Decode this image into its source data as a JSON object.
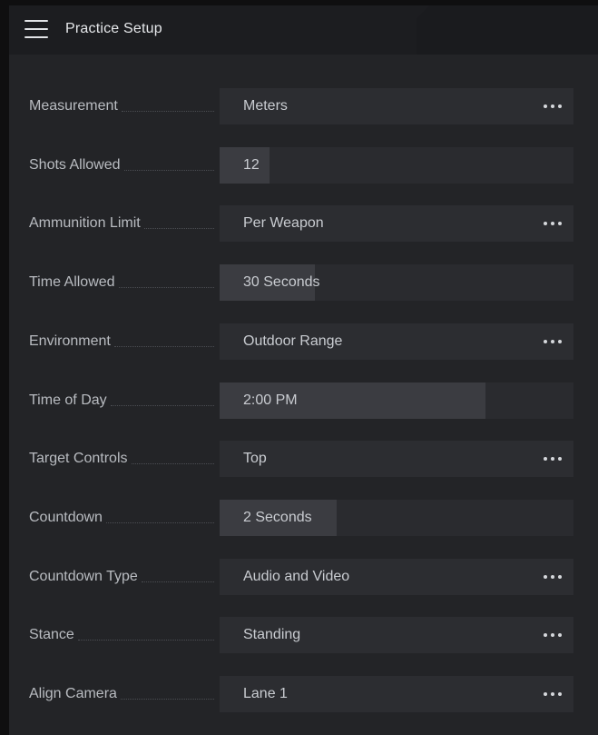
{
  "header": {
    "title": "Practice Setup",
    "menu_icon": "hamburger-icon"
  },
  "settings": [
    {
      "key": "measurement",
      "label": "Measurement",
      "value": "Meters",
      "type": "select"
    },
    {
      "key": "shots-allowed",
      "label": "Shots Allowed",
      "value": "12",
      "type": "slider",
      "fill": 0.14
    },
    {
      "key": "ammunition-limit",
      "label": "Ammunition Limit",
      "value": "Per Weapon",
      "type": "select"
    },
    {
      "key": "time-allowed",
      "label": "Time Allowed",
      "value": "30 Seconds",
      "type": "slider",
      "fill": 0.27
    },
    {
      "key": "environment",
      "label": "Environment",
      "value": "Outdoor Range",
      "type": "select"
    },
    {
      "key": "time-of-day",
      "label": "Time of Day",
      "value": "2:00 PM",
      "type": "slider",
      "fill": 0.75
    },
    {
      "key": "target-controls",
      "label": "Target Controls",
      "value": "Top",
      "type": "select"
    },
    {
      "key": "countdown",
      "label": "Countdown",
      "value": "2 Seconds",
      "type": "slider",
      "fill": 0.33
    },
    {
      "key": "countdown-type",
      "label": "Countdown Type",
      "value": "Audio and Video",
      "type": "select"
    },
    {
      "key": "stance",
      "label": "Stance",
      "value": "Standing",
      "type": "select"
    },
    {
      "key": "align-camera",
      "label": "Align Camera",
      "value": "Lane 1",
      "type": "select"
    }
  ],
  "icons": {
    "select_more": "ellipsis-icon"
  },
  "colors": {
    "background": "#232427",
    "header": "#1c1d20",
    "control": "#2c2d31",
    "slider_fill": "#3b3c41"
  }
}
